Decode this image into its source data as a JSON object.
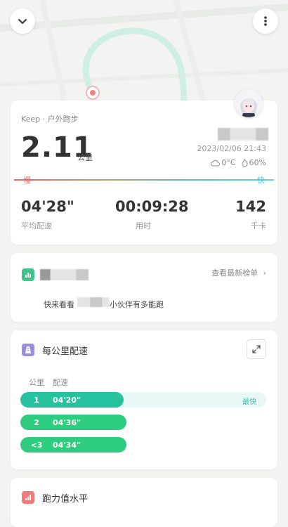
{
  "map": {
    "street_label": ""
  },
  "summary": {
    "source": "Keep · 户外跑步",
    "distance": "2.11",
    "distance_unit": "公里",
    "datetime": "2023/02/06 21:43",
    "temperature": "0°C",
    "humidity": "60%",
    "slow_label": "慢",
    "fast_label": "快",
    "stats": [
      {
        "value": "04'28\"",
        "label": "平均配速"
      },
      {
        "value": "00:09:28",
        "label": "用时"
      },
      {
        "value": "142",
        "label": "千卡"
      }
    ]
  },
  "leaderboard": {
    "link": "查看最新榜单",
    "subtitle_lead": "快来看看",
    "subtitle_tail": "小伙伴有多能跑"
  },
  "pace_section": {
    "title": "每公里配速",
    "col_km": "公里",
    "col_pace": "配速",
    "fastest_label": "最快",
    "rows": [
      {
        "km": "1",
        "pace": "04'20\"",
        "fraction": 0.42,
        "color": "#26c2a0"
      },
      {
        "km": "2",
        "pace": "04'36\"",
        "fraction": 0.43,
        "color": "#2ecc7f"
      },
      {
        "km": "<3",
        "pace": "04'34\"",
        "fraction": 0.43,
        "color": "#2ecc7f"
      }
    ]
  },
  "running_level": {
    "title": "跑力值水平"
  },
  "colors": {
    "accent": "#3ec38b",
    "slow": "#e06a6a",
    "fast": "#4fc6dd"
  }
}
